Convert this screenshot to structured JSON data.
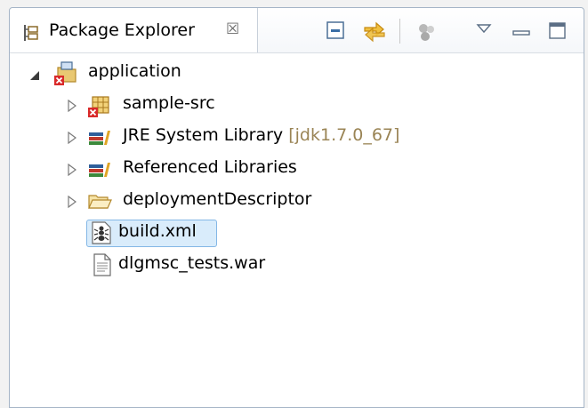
{
  "view": {
    "title": "Package Explorer",
    "close_glyph": "☒"
  },
  "toolbar": {
    "items": [
      "collapse-all-icon",
      "link-with-editor-icon",
      "filters-icon",
      "view-menu-icon",
      "minimize-icon",
      "maximize-icon"
    ]
  },
  "tree": {
    "root": {
      "label": "application",
      "expanded": true
    },
    "children": [
      {
        "label": "sample-src",
        "decoration": "",
        "icon": "package-folder-error-icon",
        "expandable": true
      },
      {
        "label": "JRE System Library",
        "decoration": "[jdk1.7.0_67]",
        "icon": "library-icon",
        "expandable": true
      },
      {
        "label": "Referenced Libraries",
        "decoration": "",
        "icon": "library-icon",
        "expandable": true
      },
      {
        "label": "deploymentDescriptor",
        "decoration": "",
        "icon": "folder-icon",
        "expandable": true
      },
      {
        "label": "build.xml",
        "decoration": "",
        "icon": "ant-build-file-icon",
        "expandable": false,
        "selected": true
      },
      {
        "label": "dlgmsc_tests.war",
        "decoration": "",
        "icon": "file-icon",
        "expandable": false
      }
    ]
  },
  "colors": {
    "selection_fill": "#d9ecfb",
    "selection_border": "#84b7e6",
    "decoration_text": "#9a8455",
    "error_marker": "#d92a2a"
  }
}
